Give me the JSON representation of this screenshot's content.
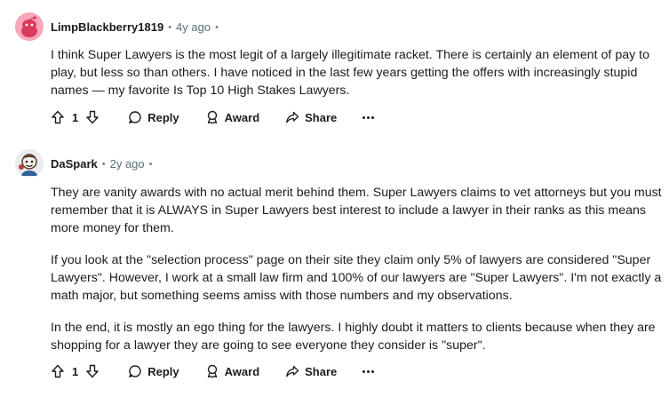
{
  "comments": [
    {
      "username": "LimpBlackberry1819",
      "time": "4y ago",
      "paragraphs": [
        "I think Super Lawyers is the most legit of a largely illegitimate racket. There is certainly an element of pay to play, but less so than others. I have noticed in the last few years getting the offers with increasingly stupid names — my favorite Is Top 10 High Stakes Lawyers."
      ],
      "votes": "1",
      "reply_label": "Reply",
      "award_label": "Award",
      "share_label": "Share"
    },
    {
      "username": "DaSpark",
      "time": "2y ago",
      "paragraphs": [
        "They are vanity awards with no actual merit behind them. Super Lawyers claims to vet attorneys but you must remember that it is ALWAYS in Super Lawyers best interest to include a lawyer in their ranks as this means more money for them.",
        "If you look at the \"selection process\" page on their site they claim only 5% of lawyers are considered \"Super Lawyers\". However, I work at a small law firm and 100% of our lawyers are \"Super Lawyers\". I'm not exactly a math major, but something seems amiss with those numbers and my observations.",
        "In the end, it is mostly an ego thing for the lawyers. I highly doubt it matters to clients because when they are shopping for a lawyer they are going to see everyone they consider is \"super\"."
      ],
      "votes": "1",
      "reply_label": "Reply",
      "award_label": "Award",
      "share_label": "Share"
    }
  ],
  "colors": {
    "avatar_pink": "#f7a8b8",
    "avatar_red": "#d93a5f",
    "meta_gray": "#576f76"
  }
}
